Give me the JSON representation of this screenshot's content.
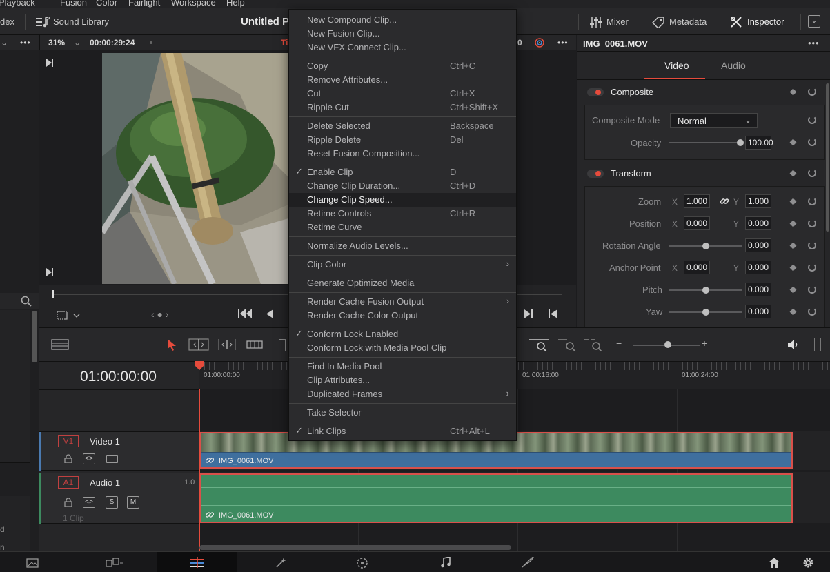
{
  "menubar": [
    "Playback",
    "Fusion",
    "Color",
    "Fairlight",
    "Workspace",
    "Help"
  ],
  "toolbar": {
    "index_label": "dex",
    "sound_library_label": "Sound Library",
    "project_title": "Untitled P",
    "mixer_label": "Mixer",
    "metadata_label": "Metadata",
    "inspector_label": "Inspector"
  },
  "viewer": {
    "zoom": "31%",
    "timecode": "00:00:29:24",
    "title_fragment": "Ti",
    "right_fragment": "0"
  },
  "inspector": {
    "clip_name": "IMG_0061.MOV",
    "tabs": [
      "Video",
      "Audio"
    ],
    "composite": {
      "header": "Composite",
      "mode_label": "Composite Mode",
      "mode_value": "Normal",
      "opacity_label": "Opacity",
      "opacity_value": "100.00"
    },
    "transform": {
      "header": "Transform",
      "zoom_label": "Zoom",
      "zoom_x": "1.000",
      "zoom_y": "1.000",
      "position_label": "Position",
      "position_x": "0.000",
      "position_y": "0.000",
      "rotation_label": "Rotation Angle",
      "rotation_value": "0.000",
      "anchor_label": "Anchor Point",
      "anchor_x": "0.000",
      "anchor_y": "0.000",
      "pitch_label": "Pitch",
      "pitch_value": "0.000",
      "yaw_label": "Yaw",
      "yaw_value": "0.000",
      "x_label": "X",
      "y_label": "Y"
    }
  },
  "timeline": {
    "timecode": "01:00:00:00",
    "ruler": [
      "01:00:00:00",
      "01:00:16:00",
      "01:00:24:00"
    ],
    "video_track": {
      "badge": "V1",
      "name": "Video 1",
      "clip": "IMG_0061.MOV"
    },
    "audio_track": {
      "badge": "A1",
      "name": "Audio 1",
      "level": "1.0",
      "clip": "IMG_0061.MOV",
      "count": "1 Clip",
      "solo": "S",
      "mute": "M"
    }
  },
  "left_fragments": [
    "d",
    "n"
  ],
  "context_menu": {
    "items": [
      {
        "label": "New Compound Clip...",
        "shortcut": ""
      },
      {
        "label": "New Fusion Clip...",
        "shortcut": ""
      },
      {
        "label": "New VFX Connect Clip...",
        "shortcut": ""
      },
      {
        "label": "Copy",
        "shortcut": "Ctrl+C"
      },
      {
        "label": "Remove Attributes...",
        "shortcut": ""
      },
      {
        "label": "Cut",
        "shortcut": "Ctrl+X"
      },
      {
        "label": "Ripple Cut",
        "shortcut": "Ctrl+Shift+X"
      },
      {
        "label": "Delete Selected",
        "shortcut": "Backspace"
      },
      {
        "label": "Ripple Delete",
        "shortcut": "Del"
      },
      {
        "label": "Reset Fusion Composition...",
        "shortcut": ""
      },
      {
        "label": "Enable Clip",
        "shortcut": "D",
        "checked": true
      },
      {
        "label": "Change Clip Duration...",
        "shortcut": "Ctrl+D"
      },
      {
        "label": "Change Clip Speed...",
        "shortcut": "",
        "highlighted": true
      },
      {
        "label": "Retime Controls",
        "shortcut": "Ctrl+R"
      },
      {
        "label": "Retime Curve",
        "shortcut": ""
      },
      {
        "label": "Normalize Audio Levels...",
        "shortcut": ""
      },
      {
        "label": "Clip Color",
        "shortcut": "",
        "submenu": true
      },
      {
        "label": "Generate Optimized Media",
        "shortcut": ""
      },
      {
        "label": "Render Cache Fusion Output",
        "shortcut": "",
        "submenu": true
      },
      {
        "label": "Render Cache Color Output",
        "shortcut": ""
      },
      {
        "label": "Conform Lock Enabled",
        "shortcut": "",
        "checked": true
      },
      {
        "label": "Conform Lock with Media Pool Clip",
        "shortcut": ""
      },
      {
        "label": "Find In Media Pool",
        "shortcut": ""
      },
      {
        "label": "Clip Attributes...",
        "shortcut": ""
      },
      {
        "label": "Duplicated Frames",
        "shortcut": "",
        "submenu": true
      },
      {
        "label": "Take Selector",
        "shortcut": ""
      },
      {
        "label": "Link Clips",
        "shortcut": "Ctrl+Alt+L",
        "checked": true
      }
    ]
  },
  "colors": {
    "accent_red": "#e64b3c",
    "video_clip_blue": "#3f6f9e",
    "audio_clip_green": "#3d8a5f",
    "clip_border": "#d9504a"
  }
}
